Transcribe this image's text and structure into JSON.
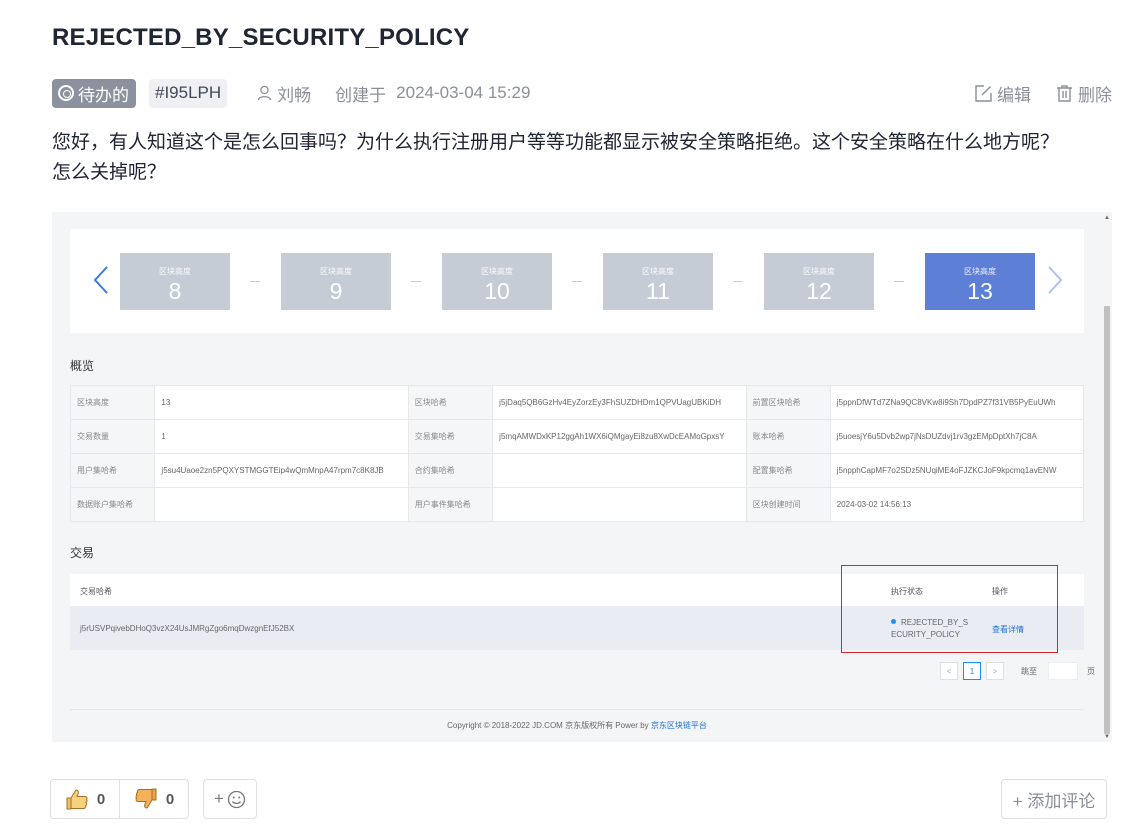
{
  "issue": {
    "title": "REJECTED_BY_SECURITY_POLICY",
    "status": "待办的",
    "id": "#I95LPH",
    "author": "刘畅",
    "created_label": "创建于",
    "created_time": "2024-03-04 15:29",
    "edit_label": "编辑",
    "delete_label": "删除",
    "body_line1": "您好，有人知道这个是怎么回事吗？为什么执行注册用户等等功能都显示被安全策略拒绝。这个安全策略在什么地方呢？",
    "body_line2": "怎么关掉呢？"
  },
  "screenshot": {
    "block_label": "区块高度",
    "blocks": [
      "8",
      "9",
      "10",
      "11",
      "12",
      "13"
    ],
    "active_block": "13",
    "overview_title": "概览",
    "overview": {
      "r1": {
        "k1": "区块高度",
        "v1": "13",
        "k2": "区块哈希",
        "v2": "j5jDaq5QB6GzHv4EyZorzEy3FhSUZDHDm1QPVUagUBKiDH",
        "k3": "前置区块哈希",
        "v3": "j5ppnDfWTd7ZNa9QC8VKw8i9Sh7DpdPZ7f31VB5PyEuUWh"
      },
      "r2": {
        "k1": "交易数量",
        "v1": "1",
        "k2": "交易集哈希",
        "v2": "j5mqAMWDxKP12ggAh1WX6iQMgayEi8zu8XwDcEAMoGpxsY",
        "k3": "账本哈希",
        "v3": "j5uoesjY6u5Dvb2wp7jNsDUZdvj1rv3gzEMpDptXh7jC8A"
      },
      "r3": {
        "k1": "用户集哈希",
        "v1": "j5su4Uaoe2zn5PQXYSTMGGTEip4wQmMnpA47rpm7c8K8JB",
        "k2": "合约集哈希",
        "v2": "",
        "k3": "配置集哈希",
        "v3": "j5npphCapMF7o2SDz5NUqiME4oFJZKCJoF9kpcmq1avENW"
      },
      "r4": {
        "k1": "数据账户集哈希",
        "v1": "",
        "k2": "用户事件集哈希",
        "v2": "",
        "k3": "区块创建时间",
        "v3": "2024-03-02 14:56:13"
      }
    },
    "tx_title": "交易",
    "tx_headers": {
      "hash": "交易哈希",
      "status": "执行状态",
      "op": "操作"
    },
    "tx_row": {
      "hash": "j5rUSVPqivebDHoQ3vzX24UsJMRgZgo6mqDwzgnEfJ52BX",
      "status_l1": "REJECTED_BY_S",
      "status_l2": "ECURITY_POLICY",
      "op": "查看详情"
    },
    "pager": {
      "prev": "<",
      "page": "1",
      "next": ">",
      "goto": "跳至",
      "unit": "页"
    },
    "copyright": "Copyright © 2018-2022 JD.COM 京东版权所有 Power by ",
    "copyright_link": "京东区块链平台"
  },
  "footer": {
    "likes": "0",
    "dislikes": "0",
    "emoji_plus": "+",
    "add_comment": "+ 添加评论"
  },
  "colors": {
    "active_block": "#5e7fd6",
    "block": "#c6ccd5",
    "highlight_box": "#e0232b",
    "status_badge": "#8c929d",
    "link": "#1f6fd8"
  }
}
